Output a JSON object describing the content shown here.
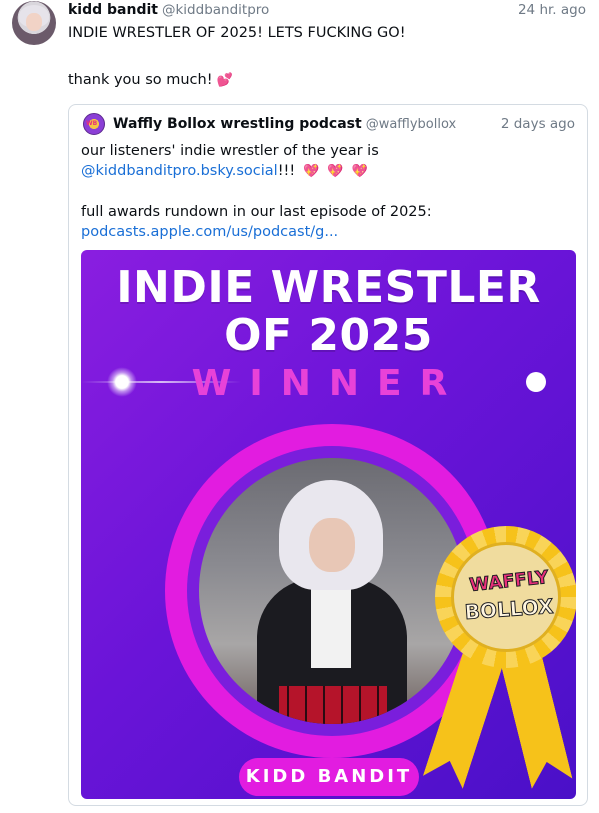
{
  "post": {
    "author_name": "kidd bandit",
    "author_handle": "@kiddbanditpro",
    "time": "24 hr. ago",
    "line1": "INDIE WRESTLER OF 2025! LETS FUCKING GO!",
    "line2": "thank you so much!",
    "line2_emoji": "💕"
  },
  "quote": {
    "author_name": "Waffly Bollox wrestling podcast",
    "author_handle": "@wafflybollox",
    "time": "2 days ago",
    "line1": "our listeners' indie wrestler of the year is",
    "mention": "@kiddbanditpro.bsky.social",
    "mention_suffix": "!!!",
    "hearts": [
      "💖",
      "💖",
      "💖"
    ],
    "line3": "full awards rundown in our last episode of 2025:",
    "link": "podcasts.apple.com/us/podcast/g..."
  },
  "card": {
    "title_line1": "INDIE WRESTLER",
    "title_line2": "OF 2025",
    "subtitle": "WINNER",
    "name_badge": "KIDD BANDIT",
    "medal_top": "WAFFLY",
    "medal_bottom": "BOLLOX"
  },
  "colors": {
    "card_bg": "#6a14d8",
    "ring": "#e21ce0",
    "winner_text": "#e842d8",
    "link": "#1a6fd6",
    "medal_gold": "#f6c21a"
  }
}
